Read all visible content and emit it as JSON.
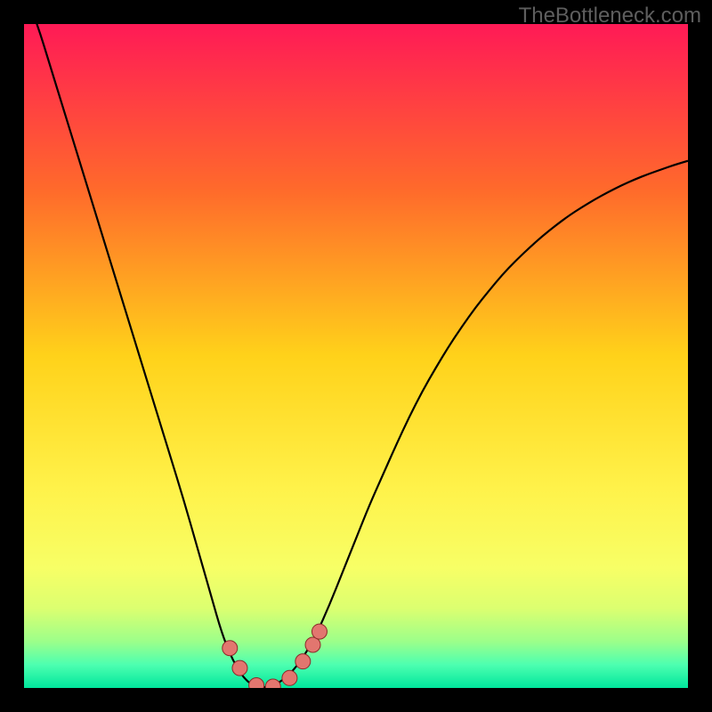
{
  "watermark": "TheBottleneck.com",
  "colors": {
    "frame": "#000000",
    "curve": "#000000",
    "marker_fill": "#e2766f",
    "marker_stroke": "#8c2a2a",
    "gradient_stops": [
      {
        "offset": 0,
        "color": "#ff1a56"
      },
      {
        "offset": 0.25,
        "color": "#ff6a2b"
      },
      {
        "offset": 0.5,
        "color": "#ffd21a"
      },
      {
        "offset": 0.7,
        "color": "#fff24a"
      },
      {
        "offset": 0.82,
        "color": "#f7ff66"
      },
      {
        "offset": 0.88,
        "color": "#dcff70"
      },
      {
        "offset": 0.93,
        "color": "#9cff8a"
      },
      {
        "offset": 0.965,
        "color": "#4dffb0"
      },
      {
        "offset": 1,
        "color": "#00e69c"
      }
    ]
  },
  "chart_data": {
    "type": "line",
    "x": [
      0.0,
      0.02,
      0.04,
      0.06,
      0.08,
      0.1,
      0.12,
      0.14,
      0.16,
      0.18,
      0.2,
      0.22,
      0.24,
      0.26,
      0.28,
      0.3,
      0.32,
      0.34,
      0.36,
      0.38,
      0.4,
      0.42,
      0.44,
      0.46,
      0.48,
      0.5,
      0.52,
      0.54,
      0.56,
      0.58,
      0.6,
      0.62,
      0.64,
      0.66,
      0.68,
      0.7,
      0.72,
      0.74,
      0.76,
      0.78,
      0.8,
      0.82,
      0.84,
      0.86,
      0.88,
      0.9,
      0.92,
      0.94,
      0.96,
      0.98,
      1.0
    ],
    "series": [
      {
        "name": "bottleneck-curve",
        "values": [
          1.05,
          1.0,
          0.935,
          0.87,
          0.805,
          0.74,
          0.675,
          0.61,
          0.545,
          0.48,
          0.415,
          0.35,
          0.285,
          0.215,
          0.145,
          0.075,
          0.03,
          0.005,
          0.0,
          0.005,
          0.02,
          0.045,
          0.08,
          0.125,
          0.175,
          0.225,
          0.275,
          0.32,
          0.365,
          0.408,
          0.447,
          0.482,
          0.515,
          0.545,
          0.573,
          0.598,
          0.622,
          0.643,
          0.662,
          0.68,
          0.696,
          0.711,
          0.724,
          0.736,
          0.747,
          0.757,
          0.766,
          0.774,
          0.781,
          0.788,
          0.794
        ]
      }
    ],
    "markers": [
      {
        "x": 0.31,
        "y": 0.06
      },
      {
        "x": 0.325,
        "y": 0.03
      },
      {
        "x": 0.35,
        "y": 0.004
      },
      {
        "x": 0.375,
        "y": 0.002
      },
      {
        "x": 0.4,
        "y": 0.015
      },
      {
        "x": 0.42,
        "y": 0.04
      },
      {
        "x": 0.435,
        "y": 0.065
      },
      {
        "x": 0.445,
        "y": 0.085
      }
    ],
    "title": "",
    "xlabel": "",
    "ylabel": "",
    "xlim": [
      0,
      1
    ],
    "ylim": [
      0,
      1
    ]
  }
}
